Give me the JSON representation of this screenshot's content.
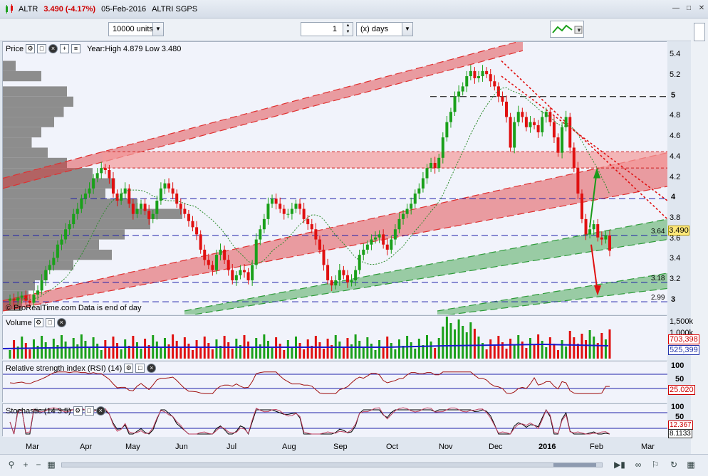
{
  "header": {
    "symbol": "ALTR",
    "price_change": "3.490 (-4.17%)",
    "date": "05-Feb-2016",
    "name": "ALTRI SGPS"
  },
  "toolbar": {
    "units": "10000 units",
    "period_value": "1",
    "period_unit": "(x) days"
  },
  "price_panel": {
    "label": "Price",
    "info": "Year:High 4.879 Low 3.480",
    "footer": "© ProRealTime.com  Data is end of day",
    "current_price": "3.490",
    "line_labels": [
      "3.64",
      "3.18",
      "2.99"
    ],
    "yticks": [
      "5.4",
      "5.2",
      "5",
      "4.8",
      "4.6",
      "4.4",
      "4.2",
      "4",
      "3.8",
      "3.6",
      "3.4",
      "3.2",
      "3"
    ]
  },
  "volume_panel": {
    "label": "Volume",
    "yticks": [
      "1,500k",
      "1,000k"
    ],
    "value1": "703,398",
    "value2": "525,399"
  },
  "rsi_panel": {
    "label": "Relative strength index (RSI) (14)",
    "yticks": [
      "100",
      "50"
    ],
    "value": "25.020"
  },
  "stoch_panel": {
    "label": "Stochastic (14 3 5)",
    "yticks": [
      "100",
      "50"
    ],
    "value1": "12.367",
    "value2": "8.1133"
  },
  "xaxis": [
    "Mar",
    "Apr",
    "May",
    "Jun",
    "Jul",
    "Aug",
    "Sep",
    "Oct",
    "Nov",
    "Dec",
    "2016",
    "Feb",
    "Mar"
  ],
  "colors": {
    "up": "#1aa01a",
    "down": "#e01010",
    "red_channel": "#f08a8a",
    "green_channel": "#4caf50",
    "volume_ma": "#1a1acc",
    "price_box": "#ffe97a"
  },
  "chart_data": {
    "type": "candlestick",
    "title": "ALTR",
    "ylim": [
      2.9,
      5.5
    ],
    "closes": [
      3.02,
      3.0,
      3.03,
      3.05,
      3.0,
      2.98,
      3.06,
      3.1,
      3.2,
      3.3,
      3.35,
      3.42,
      3.55,
      3.6,
      3.7,
      3.75,
      3.85,
      3.9,
      4.0,
      4.05,
      4.1,
      4.2,
      4.25,
      4.3,
      4.28,
      4.2,
      4.05,
      3.98,
      4.05,
      4.1,
      3.95,
      3.85,
      3.9,
      3.95,
      3.88,
      3.8,
      3.85,
      3.98,
      4.1,
      4.15,
      4.1,
      4.05,
      3.95,
      3.9,
      3.85,
      3.78,
      3.72,
      3.65,
      3.5,
      3.4,
      3.35,
      3.3,
      3.45,
      3.5,
      3.4,
      3.3,
      3.2,
      3.25,
      3.3,
      3.28,
      3.2,
      3.35,
      3.6,
      3.7,
      3.8,
      3.95,
      4.0,
      3.95,
      3.9,
      3.85,
      3.85,
      3.9,
      3.95,
      3.9,
      3.8,
      3.75,
      3.7,
      3.6,
      3.5,
      3.35,
      3.2,
      3.15,
      3.2,
      3.3,
      3.25,
      3.18,
      3.2,
      3.3,
      3.45,
      3.5,
      3.55,
      3.6,
      3.62,
      3.65,
      3.55,
      3.5,
      3.6,
      3.7,
      3.8,
      3.85,
      3.9,
      3.95,
      4.05,
      4.1,
      4.2,
      4.3,
      4.35,
      4.3,
      4.4,
      4.6,
      4.75,
      4.85,
      5.0,
      5.05,
      5.1,
      5.2,
      5.25,
      5.18,
      5.2,
      5.25,
      5.22,
      5.15,
      5.1,
      5.0,
      4.95,
      4.8,
      4.5,
      4.75,
      4.85,
      4.8,
      4.7,
      4.75,
      4.72,
      4.65,
      4.8,
      4.85,
      4.75,
      4.6,
      4.45,
      4.7,
      4.8,
      4.5,
      4.3,
      4.05,
      3.8,
      3.65,
      3.7,
      3.75,
      3.62,
      3.6,
      3.64,
      3.49
    ]
  }
}
